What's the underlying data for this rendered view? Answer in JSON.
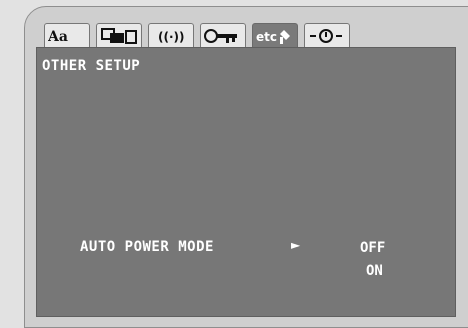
{
  "tabs": [
    {
      "name": "language",
      "icon": "language-icon",
      "label": "Aa"
    },
    {
      "name": "display",
      "icon": "display-icon"
    },
    {
      "name": "audio",
      "icon": "audio-icon",
      "label": "((·))"
    },
    {
      "name": "parental",
      "icon": "key-icon"
    },
    {
      "name": "other",
      "icon": "etc-icon",
      "label": "etc",
      "active": true
    },
    {
      "name": "timer",
      "icon": "timer-icon"
    }
  ],
  "screen": {
    "title": "OTHER SETUP",
    "option": {
      "label": "AUTO POWER MODE",
      "selected": "OFF",
      "options": [
        "OFF",
        "ON"
      ]
    }
  },
  "colors": {
    "panel": "#cfcfcf",
    "screen": "#777777",
    "active_tab": "#7a7a7a",
    "text": "#ffffff"
  }
}
